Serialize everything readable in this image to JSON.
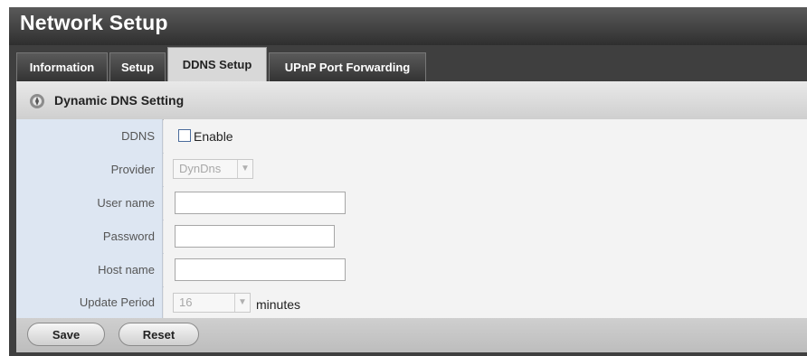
{
  "page": {
    "title": "Network Setup"
  },
  "tabs": [
    {
      "label": "Information",
      "active": false
    },
    {
      "label": "Setup",
      "active": false
    },
    {
      "label": "DDNS Setup",
      "active": true
    },
    {
      "label": "UPnP Port Forwarding",
      "active": false
    }
  ],
  "section": {
    "title": "Dynamic DNS Setting",
    "icon": "gear-icon"
  },
  "form": {
    "ddns": {
      "label": "DDNS",
      "checkbox_label": "Enable",
      "checked": false
    },
    "provider": {
      "label": "Provider",
      "value": "DynDns",
      "disabled": true
    },
    "username": {
      "label": "User name",
      "value": ""
    },
    "password": {
      "label": "Password",
      "value": ""
    },
    "hostname": {
      "label": "Host name",
      "value": ""
    },
    "update_period": {
      "label": "Update Period",
      "value": "16",
      "unit": "minutes",
      "disabled": true
    }
  },
  "buttons": {
    "save": "Save",
    "reset": "Reset"
  },
  "colors": {
    "header_bg": "#3f3f3f",
    "label_bg": "#dde6f2",
    "active_tab_bg": "#d8d8d8"
  }
}
